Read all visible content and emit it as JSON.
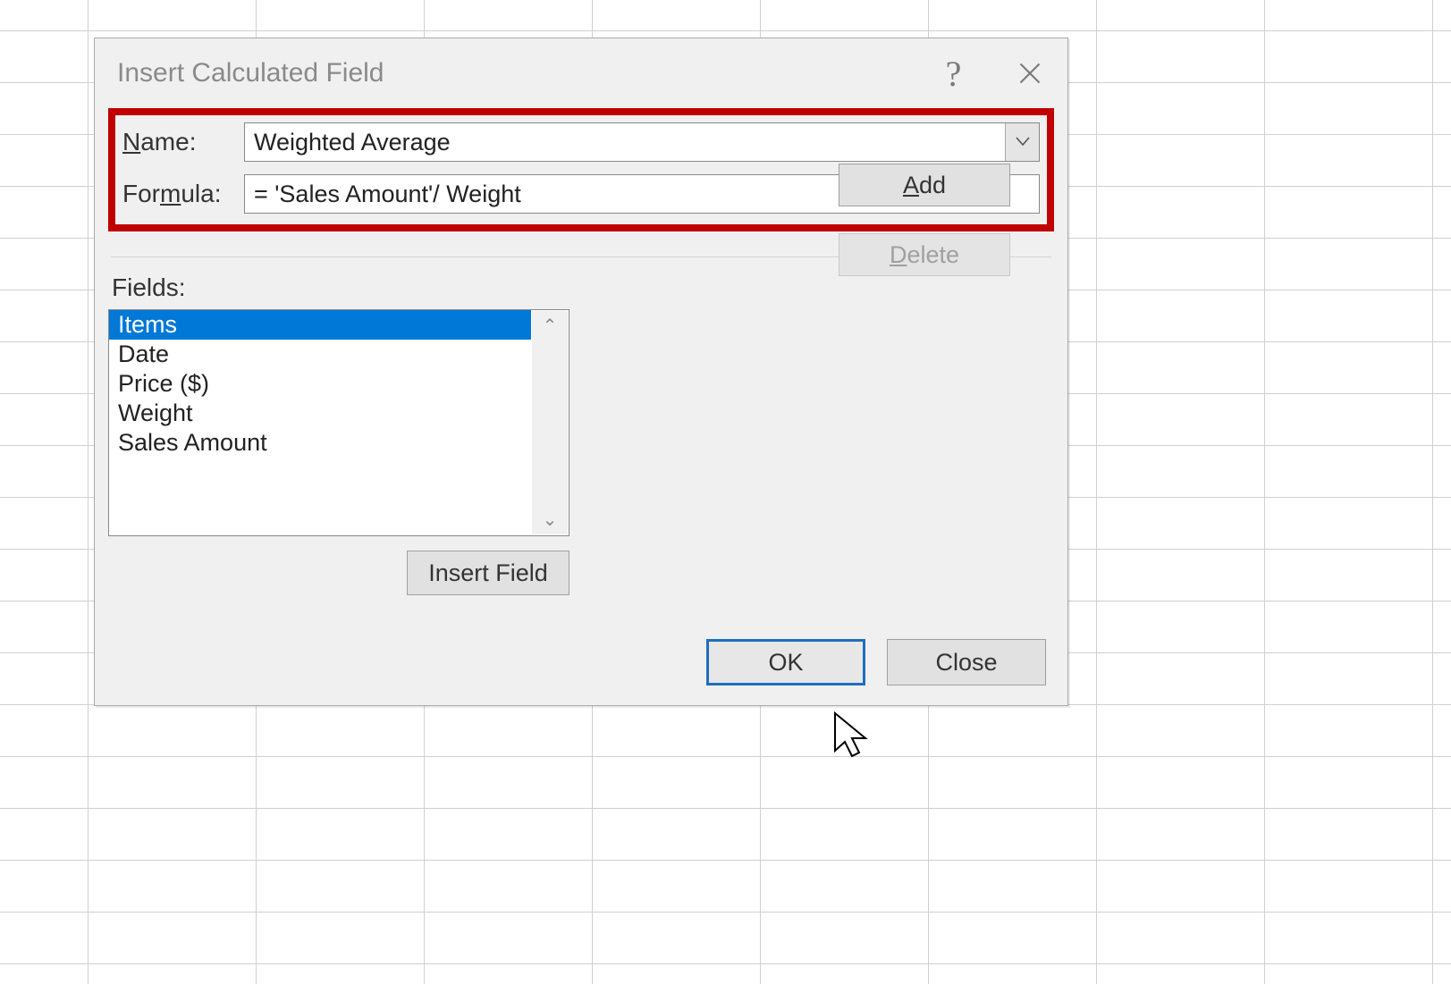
{
  "dialog": {
    "title": "Insert Calculated Field",
    "nameLabelPrefix": "N",
    "nameLabelRest": "ame:",
    "formulaLabelPre": "For",
    "formulaLabelMid": "m",
    "formulaLabelPost": "ula:",
    "nameValue": "Weighted Average",
    "formulaValue": "= 'Sales Amount'/ Weight",
    "addPrefix": "A",
    "addRest": "dd",
    "deletePrefix": "D",
    "deleteRest": "elete",
    "fieldsLabelPrefix": "F",
    "fieldsLabelRest": "ields:",
    "fields": [
      "Items",
      "Date",
      "Price ($)",
      "Weight",
      "Sales Amount"
    ],
    "selectedFieldIndex": 0,
    "insertFieldLabel": "Insert Field",
    "okLabel": "OK",
    "closeLabel": "Close"
  }
}
